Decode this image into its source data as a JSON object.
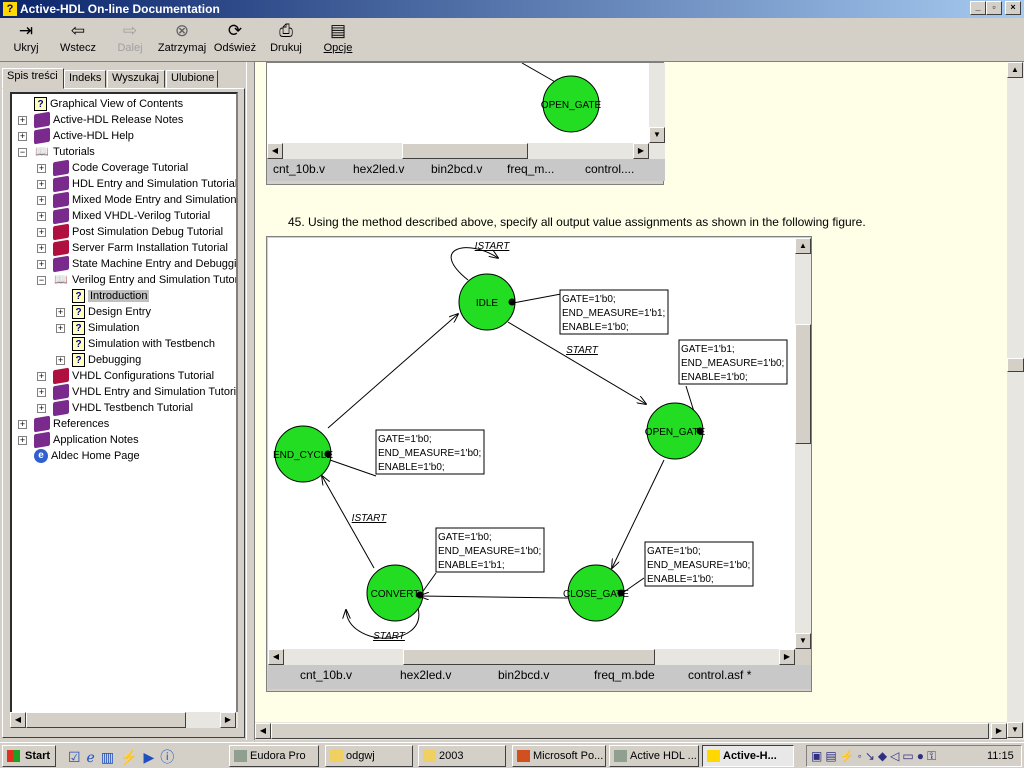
{
  "window": {
    "title": "Active-HDL On-line Documentation"
  },
  "toolbar": {
    "items": [
      {
        "label": "Ukryj",
        "icon": "hide-pane-icon",
        "enabled": true
      },
      {
        "label": "Wstecz",
        "icon": "back-arrow-icon",
        "enabled": true
      },
      {
        "label": "Dalej",
        "icon": "forward-arrow-icon",
        "enabled": false
      },
      {
        "label": "Zatrzymaj",
        "icon": "stop-icon",
        "enabled": true
      },
      {
        "label": "Odśwież",
        "icon": "refresh-icon",
        "enabled": true
      },
      {
        "label": "Drukuj",
        "icon": "print-icon",
        "enabled": true
      },
      {
        "label": "Opcje",
        "icon": "options-icon",
        "enabled": true
      }
    ]
  },
  "nav_tabs": [
    "Spis treści",
    "Indeks",
    "Wyszukaj",
    "Ulubione"
  ],
  "tree": [
    {
      "label": "Graphical View of Contents",
      "icon": "help-page",
      "level": 0,
      "expander": ""
    },
    {
      "label": "Active-HDL Release Notes",
      "icon": "book",
      "level": 0,
      "expander": "+"
    },
    {
      "label": "Active-HDL Help",
      "icon": "book",
      "level": 0,
      "expander": "+"
    },
    {
      "label": "Tutorials",
      "icon": "open-book",
      "level": 0,
      "expander": "-"
    },
    {
      "label": "Code Coverage Tutorial",
      "icon": "book",
      "level": 1,
      "expander": "+"
    },
    {
      "label": "HDL Entry and Simulation Tutorial",
      "icon": "book",
      "level": 1,
      "expander": "+"
    },
    {
      "label": "Mixed Mode Entry and Simulation T",
      "icon": "book",
      "level": 1,
      "expander": "+"
    },
    {
      "label": "Mixed VHDL-Verilog Tutorial",
      "icon": "book",
      "level": 1,
      "expander": "+"
    },
    {
      "label": "Post Simulation Debug Tutorial",
      "icon": "book-red",
      "level": 1,
      "expander": "+"
    },
    {
      "label": "Server Farm Installation Tutorial",
      "icon": "book-red",
      "level": 1,
      "expander": "+"
    },
    {
      "label": "State Machine Entry and Debuggin",
      "icon": "book",
      "level": 1,
      "expander": "+"
    },
    {
      "label": "Verilog Entry and Simulation Tutoria",
      "icon": "open-book",
      "level": 1,
      "expander": "-"
    },
    {
      "label": "Introduction",
      "icon": "help-page",
      "level": 2,
      "expander": "",
      "selected": true
    },
    {
      "label": "Design Entry",
      "icon": "help-page",
      "level": 2,
      "expander": "+"
    },
    {
      "label": "Simulation",
      "icon": "help-page",
      "level": 2,
      "expander": "+"
    },
    {
      "label": "Simulation with Testbench",
      "icon": "help-page",
      "level": 2,
      "expander": ""
    },
    {
      "label": "Debugging",
      "icon": "help-page",
      "level": 2,
      "expander": "+"
    },
    {
      "label": "VHDL Configurations Tutorial",
      "icon": "book-red",
      "level": 1,
      "expander": "+"
    },
    {
      "label": "VHDL Entry and Simulation Tutoria",
      "icon": "book",
      "level": 1,
      "expander": "+"
    },
    {
      "label": "VHDL Testbench Tutorial",
      "icon": "book",
      "level": 1,
      "expander": "+"
    },
    {
      "label": "References",
      "icon": "book",
      "level": 0,
      "expander": "+"
    },
    {
      "label": "Application Notes",
      "icon": "book",
      "level": 0,
      "expander": "+"
    },
    {
      "label": "Aldec Home Page",
      "icon": "globe-page",
      "level": 0,
      "expander": ""
    }
  ],
  "content": {
    "top_figure": {
      "state": "OPEN_GATE",
      "tabs": [
        "cnt_10b.v",
        "hex2led.v",
        "bin2bcd.v",
        "freq_m...",
        "control...."
      ]
    },
    "step_text": "45. Using the method described above, specify all output value assignments as shown in the following figure.",
    "figure": {
      "state_color": "#22dd22",
      "states": [
        "IDLE",
        "OPEN_GATE",
        "CLOSE_GATE",
        "CONVERT",
        "END_CYCLE"
      ],
      "transition_labels": {
        "idle_loop": "ISTART",
        "idle_to_open": "START",
        "end_to_idle_from_convert": "ISTART",
        "convert_loop": "START"
      },
      "outputs": {
        "IDLE": [
          "GATE=1'b0;",
          "END_MEASURE=1'b1;",
          "ENABLE=1'b0;"
        ],
        "OPEN_GATE": [
          "GATE=1'b1;",
          "END_MEASURE=1'b0;",
          "ENABLE=1'b0;"
        ],
        "END_CYCLE": [
          "GATE=1'b0;",
          "END_MEASURE=1'b0;",
          "ENABLE=1'b0;"
        ],
        "CONVERT": [
          "GATE=1'b0;",
          "END_MEASURE=1'b0;",
          "ENABLE=1'b1;"
        ],
        "CLOSE_GATE": [
          "GATE=1'b0;",
          "END_MEASURE=1'b0;",
          "ENABLE=1'b0;"
        ]
      },
      "tabs": [
        "cnt_10b.v",
        "hex2led.v",
        "bin2bcd.v",
        "freq_m.bde",
        "control.asf *"
      ]
    }
  },
  "taskbar": {
    "start": "Start",
    "tasks": [
      {
        "label": "Eudora Pro"
      },
      {
        "label": "odgwj"
      },
      {
        "label": "2003"
      },
      {
        "label": "Microsoft Po..."
      },
      {
        "label": "Active HDL ..."
      },
      {
        "label": "Active-H...",
        "active": true
      }
    ],
    "clock": "11:15"
  }
}
